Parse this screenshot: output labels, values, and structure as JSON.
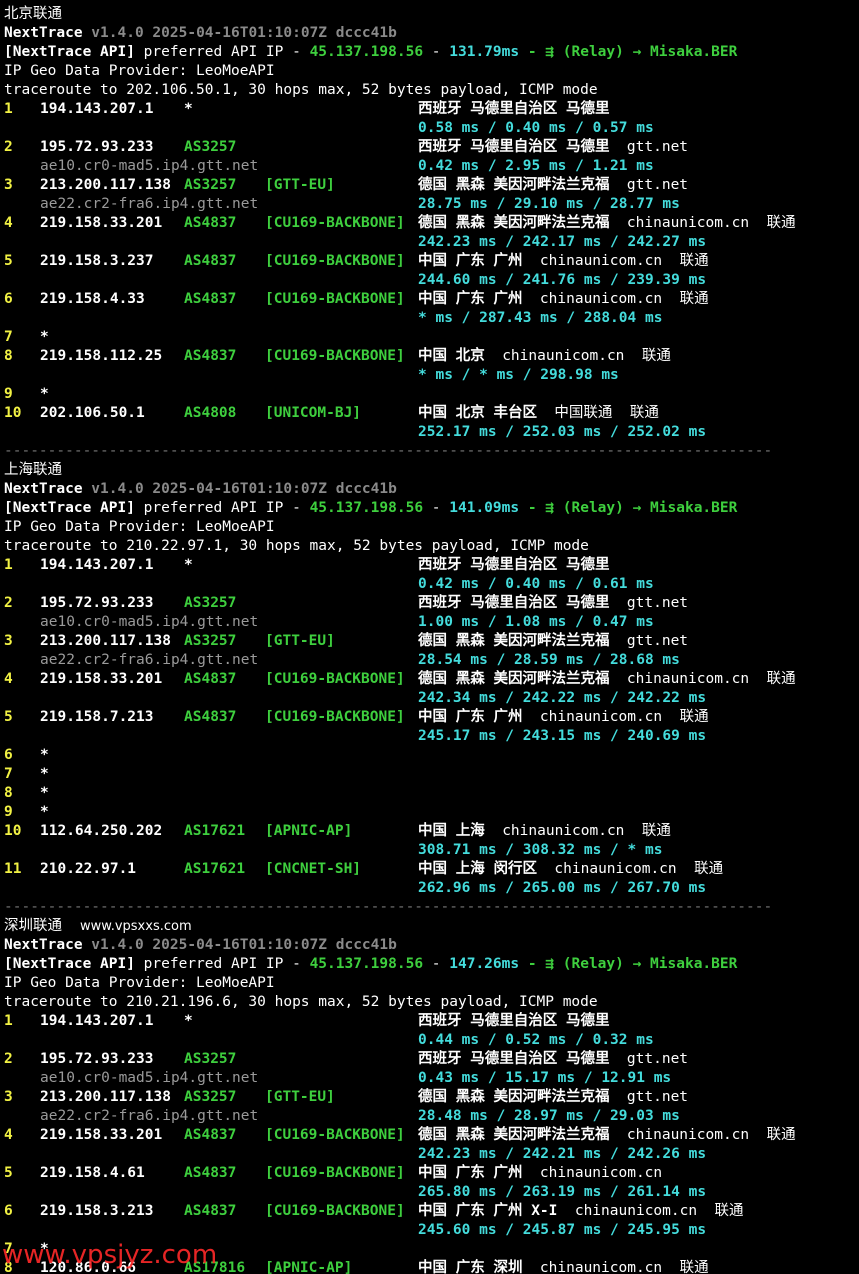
{
  "sections": [
    {
      "title": "北京联通",
      "watermark": "",
      "version": "v1.4.0 2025-04-16T01:10:07Z dccc41b",
      "api_line": {
        "prefix": "[NextTrace API]",
        "text": " preferred API IP - ",
        "ip": "45.137.198.56",
        "dash": " - ",
        "latency": "131.79ms",
        "relay": " - ⇶ (Relay) → Misaka.BER"
      },
      "geo_provider": "IP Geo Data Provider: LeoMoeAPI",
      "traceroute": "traceroute to 202.106.50.1, 30 hops max, 52 bytes payload, ICMP mode",
      "hops": [
        {
          "n": "1",
          "ip": "194.143.207.1",
          "asn": "*",
          "tag": "",
          "geo": "西班牙 马德里自治区 马德里",
          "host": "",
          "isp": "",
          "domain": "",
          "lat": "0.58 ms / 0.40 ms / 0.57 ms"
        },
        {
          "n": "2",
          "ip": "195.72.93.233",
          "asn": "AS3257",
          "tag": "",
          "geo": "西班牙 马德里自治区 马德里",
          "host": "gtt.net",
          "isp": "",
          "domain": "ae10.cr0-mad5.ip4.gtt.net",
          "lat": "0.42 ms / 2.95 ms / 1.21 ms"
        },
        {
          "n": "3",
          "ip": "213.200.117.138",
          "asn": "AS3257",
          "tag": "[GTT-EU]",
          "geo": "德国 黑森 美因河畔法兰克福",
          "host": "gtt.net",
          "isp": "",
          "domain": "ae22.cr2-fra6.ip4.gtt.net",
          "lat": "28.75 ms / 29.10 ms / 28.77 ms"
        },
        {
          "n": "4",
          "ip": "219.158.33.201",
          "asn": "AS4837",
          "tag": "[CU169-BACKBONE]",
          "geo": "德国 黑森 美因河畔法兰克福",
          "host": "chinaunicom.cn",
          "isp": "联通",
          "domain": "",
          "lat": "242.23 ms / 242.17 ms / 242.27 ms"
        },
        {
          "n": "5",
          "ip": "219.158.3.237",
          "asn": "AS4837",
          "tag": "[CU169-BACKBONE]",
          "geo": "中国 广东 广州",
          "host": "chinaunicom.cn",
          "isp": "联通",
          "domain": "",
          "lat": "244.60 ms / 241.76 ms / 239.39 ms"
        },
        {
          "n": "6",
          "ip": "219.158.4.33",
          "asn": "AS4837",
          "tag": "[CU169-BACKBONE]",
          "geo": "中国 广东 广州",
          "host": "chinaunicom.cn",
          "isp": "联通",
          "domain": "",
          "lat": "* ms / 287.43 ms / 288.04 ms"
        },
        {
          "n": "7",
          "ip": "*",
          "asn": "",
          "tag": "",
          "geo": "",
          "host": "",
          "isp": "",
          "domain": "",
          "lat": ""
        },
        {
          "n": "8",
          "ip": "219.158.112.25",
          "asn": "AS4837",
          "tag": "[CU169-BACKBONE]",
          "geo": "中国 北京",
          "host": "chinaunicom.cn",
          "isp": "联通",
          "domain": "",
          "lat": "* ms / * ms / 298.98 ms"
        },
        {
          "n": "9",
          "ip": "*",
          "asn": "",
          "tag": "",
          "geo": "",
          "host": "",
          "isp": "",
          "domain": "",
          "lat": ""
        },
        {
          "n": "10",
          "ip": "202.106.50.1",
          "asn": "AS4808",
          "tag": "[UNICOM-BJ]",
          "geo": "中国 北京 丰台区",
          "host": "中国联通",
          "isp": "联通",
          "domain": "",
          "lat": "252.17 ms / 252.03 ms / 252.02 ms"
        }
      ]
    },
    {
      "title": "上海联通",
      "watermark": "",
      "version": "v1.4.0 2025-04-16T01:10:07Z dccc41b",
      "api_line": {
        "prefix": "[NextTrace API]",
        "text": " preferred API IP - ",
        "ip": "45.137.198.56",
        "dash": " - ",
        "latency": "141.09ms",
        "relay": " - ⇶ (Relay) → Misaka.BER"
      },
      "geo_provider": "IP Geo Data Provider: LeoMoeAPI",
      "traceroute": "traceroute to 210.22.97.1, 30 hops max, 52 bytes payload, ICMP mode",
      "hops": [
        {
          "n": "1",
          "ip": "194.143.207.1",
          "asn": "*",
          "tag": "",
          "geo": "西班牙 马德里自治区 马德里",
          "host": "",
          "isp": "",
          "domain": "",
          "lat": "0.42 ms / 0.40 ms / 0.61 ms"
        },
        {
          "n": "2",
          "ip": "195.72.93.233",
          "asn": "AS3257",
          "tag": "",
          "geo": "西班牙 马德里自治区 马德里",
          "host": "gtt.net",
          "isp": "",
          "domain": "ae10.cr0-mad5.ip4.gtt.net",
          "lat": "1.00 ms / 1.08 ms / 0.47 ms"
        },
        {
          "n": "3",
          "ip": "213.200.117.138",
          "asn": "AS3257",
          "tag": "[GTT-EU]",
          "geo": "德国 黑森 美因河畔法兰克福",
          "host": "gtt.net",
          "isp": "",
          "domain": "ae22.cr2-fra6.ip4.gtt.net",
          "lat": "28.54 ms / 28.59 ms / 28.68 ms"
        },
        {
          "n": "4",
          "ip": "219.158.33.201",
          "asn": "AS4837",
          "tag": "[CU169-BACKBONE]",
          "geo": "德国 黑森 美因河畔法兰克福",
          "host": "chinaunicom.cn",
          "isp": "联通",
          "domain": "",
          "lat": "242.34 ms / 242.22 ms / 242.22 ms"
        },
        {
          "n": "5",
          "ip": "219.158.7.213",
          "asn": "AS4837",
          "tag": "[CU169-BACKBONE]",
          "geo": "中国 广东 广州",
          "host": "chinaunicom.cn",
          "isp": "联通",
          "domain": "",
          "lat": "245.17 ms / 243.15 ms / 240.69 ms"
        },
        {
          "n": "6",
          "ip": "*",
          "asn": "",
          "tag": "",
          "geo": "",
          "host": "",
          "isp": "",
          "domain": "",
          "lat": ""
        },
        {
          "n": "7",
          "ip": "*",
          "asn": "",
          "tag": "",
          "geo": "",
          "host": "",
          "isp": "",
          "domain": "",
          "lat": ""
        },
        {
          "n": "8",
          "ip": "*",
          "asn": "",
          "tag": "",
          "geo": "",
          "host": "",
          "isp": "",
          "domain": "",
          "lat": ""
        },
        {
          "n": "9",
          "ip": "*",
          "asn": "",
          "tag": "",
          "geo": "",
          "host": "",
          "isp": "",
          "domain": "",
          "lat": ""
        },
        {
          "n": "10",
          "ip": "112.64.250.202",
          "asn": "AS17621",
          "tag": "[APNIC-AP]",
          "geo": "中国 上海",
          "host": "chinaunicom.cn",
          "isp": "联通",
          "domain": "",
          "lat": "308.71 ms / 308.32 ms / * ms"
        },
        {
          "n": "11",
          "ip": "210.22.97.1",
          "asn": "AS17621",
          "tag": "[CNCNET-SH]",
          "geo": "中国 上海 闵行区",
          "host": "chinaunicom.cn",
          "isp": "联通",
          "domain": "",
          "lat": "262.96 ms / 265.00 ms / 267.70 ms"
        }
      ]
    },
    {
      "title": "深圳联通",
      "watermark": "www.vpsxxs.com",
      "version": "v1.4.0 2025-04-16T01:10:07Z dccc41b",
      "api_line": {
        "prefix": "[NextTrace API]",
        "text": " preferred API IP - ",
        "ip": "45.137.198.56",
        "dash": " - ",
        "latency": "147.26ms",
        "relay": " - ⇶ (Relay) → Misaka.BER"
      },
      "geo_provider": "IP Geo Data Provider: LeoMoeAPI",
      "traceroute": "traceroute to 210.21.196.6, 30 hops max, 52 bytes payload, ICMP mode",
      "hops": [
        {
          "n": "1",
          "ip": "194.143.207.1",
          "asn": "*",
          "tag": "",
          "geo": "西班牙 马德里自治区 马德里",
          "host": "",
          "isp": "",
          "domain": "",
          "lat": "0.44 ms / 0.52 ms / 0.32 ms"
        },
        {
          "n": "2",
          "ip": "195.72.93.233",
          "asn": "AS3257",
          "tag": "",
          "geo": "西班牙 马德里自治区 马德里",
          "host": "gtt.net",
          "isp": "",
          "domain": "ae10.cr0-mad5.ip4.gtt.net",
          "lat": "0.43 ms / 15.17 ms / 12.91 ms"
        },
        {
          "n": "3",
          "ip": "213.200.117.138",
          "asn": "AS3257",
          "tag": "[GTT-EU]",
          "geo": "德国 黑森 美因河畔法兰克福",
          "host": "gtt.net",
          "isp": "",
          "domain": "ae22.cr2-fra6.ip4.gtt.net",
          "lat": "28.48 ms / 28.97 ms / 29.03 ms"
        },
        {
          "n": "4",
          "ip": "219.158.33.201",
          "asn": "AS4837",
          "tag": "[CU169-BACKBONE]",
          "geo": "德国 黑森 美因河畔法兰克福",
          "host": "chinaunicom.cn",
          "isp": "联通",
          "domain": "",
          "lat": "242.23 ms / 242.21 ms / 242.26 ms"
        },
        {
          "n": "5",
          "ip": "219.158.4.61",
          "asn": "AS4837",
          "tag": "[CU169-BACKBONE]",
          "geo": "中国 广东 广州",
          "host": "chinaunicom.cn",
          "isp": "",
          "domain": "",
          "lat": "265.80 ms / 263.19 ms / 261.14 ms"
        },
        {
          "n": "6",
          "ip": "219.158.3.213",
          "asn": "AS4837",
          "tag": "[CU169-BACKBONE]",
          "geo": "中国 广东 广州 X-I",
          "host": "chinaunicom.cn",
          "isp": "联通",
          "domain": "",
          "lat": "245.60 ms / 245.87 ms / 245.95 ms"
        },
        {
          "n": "7",
          "ip": "*",
          "asn": "",
          "tag": "",
          "geo": "",
          "host": "",
          "isp": "",
          "domain": "",
          "lat": ""
        },
        {
          "n": "8",
          "ip": "120.86.0.66",
          "asn": "AS17816",
          "tag": "[APNIC-AP]",
          "geo": "中国 广东 深圳",
          "host": "chinaunicom.cn",
          "isp": "联通",
          "domain": "",
          "lat": ""
        }
      ]
    }
  ],
  "brand": "NextTrace",
  "separator": "----------------------------------------------------------------------------------------",
  "watermark_bottom": "www.vpsjyz.com"
}
